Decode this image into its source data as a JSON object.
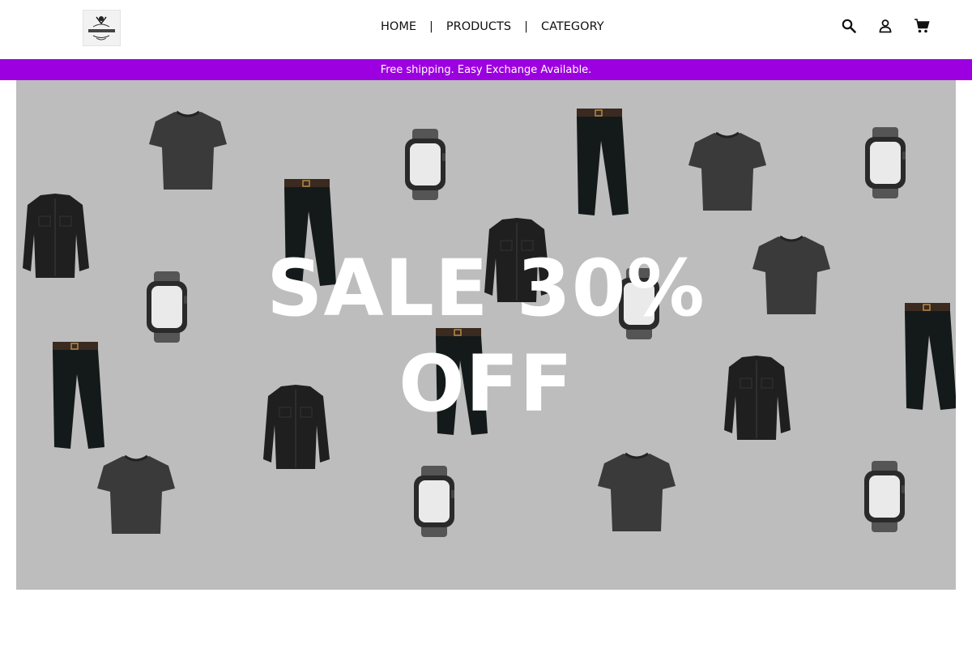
{
  "header": {
    "logo_text": "Fashion Frenzy",
    "nav": [
      {
        "label": "HOME"
      },
      {
        "label": "PRODUCTS"
      },
      {
        "label": "CATEGORY"
      }
    ],
    "separator": "|",
    "icons": [
      "search-icon",
      "user-icon",
      "cart-icon"
    ]
  },
  "promo": {
    "text": "Free shipping. Easy Exchange Available.",
    "color": "#9c00e0"
  },
  "hero": {
    "line1": "SALE 30%",
    "line2": "OFF",
    "background": "#bdbdbd",
    "products": [
      "tshirt",
      "jeans",
      "shirt",
      "watch"
    ]
  }
}
